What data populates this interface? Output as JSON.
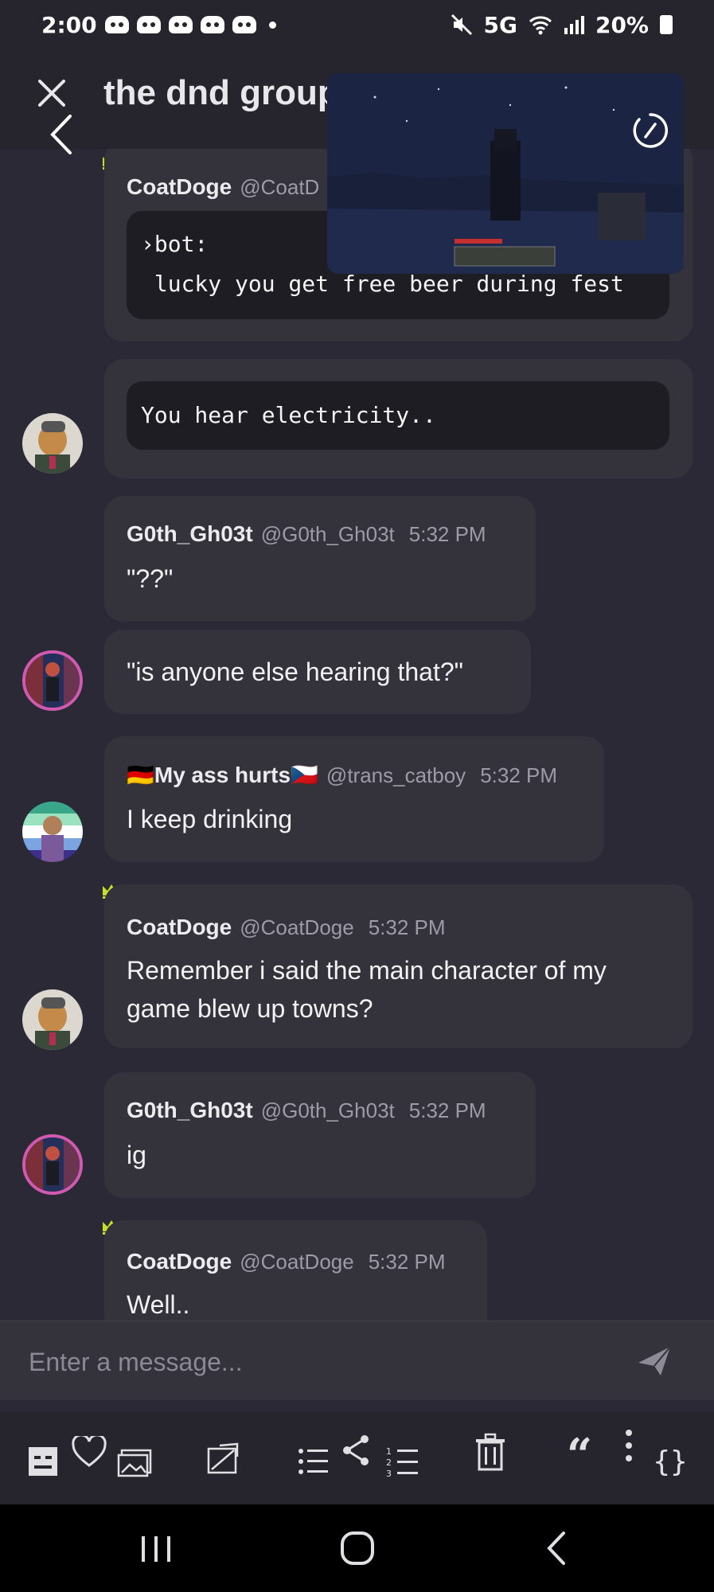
{
  "status_bar": {
    "time": "2:00",
    "network": "5G",
    "battery": "20%"
  },
  "header": {
    "title": "the dnd group"
  },
  "messages": [
    {
      "author": "CoatDoge",
      "handle": "@CoatD",
      "code_lines": [
        "›bot:",
        " lucky you get free beer during fest"
      ]
    },
    {
      "code": "You hear electricity.."
    },
    {
      "author": "G0th_Gh03t",
      "handle": "@G0th_Gh03t",
      "time": "5:32 PM",
      "text": "\"??\""
    },
    {
      "text": "\"is anyone else hearing that?\""
    },
    {
      "author_flag_left": "🇩🇪",
      "author": "My ass hurts",
      "author_flag_right": "🇨🇿",
      "handle": "@trans_catboy",
      "time": "5:32 PM",
      "text": "I keep drinking"
    },
    {
      "author": "CoatDoge",
      "handle": "@CoatDoge",
      "time": "5:32 PM",
      "text_line1": "Remember i said the main character of my",
      "text_line2": "game blew up towns?"
    },
    {
      "author": "G0th_Gh03t",
      "handle": "@G0th_Gh03t",
      "time": "5:32 PM",
      "text": "ig"
    },
    {
      "author": "CoatDoge",
      "handle": "@CoatDoge",
      "time": "5:32 PM",
      "text": "Well.."
    }
  ],
  "composer": {
    "placeholder": "Enter a message..."
  },
  "toolbar": {
    "quote_glyph": "“",
    "code_glyph": "{}"
  },
  "colors": {
    "background": "#2a2935",
    "bubble": "#34333c",
    "code_block": "#1e1d24",
    "crown": "#c6e02a",
    "header": "#26252d"
  }
}
